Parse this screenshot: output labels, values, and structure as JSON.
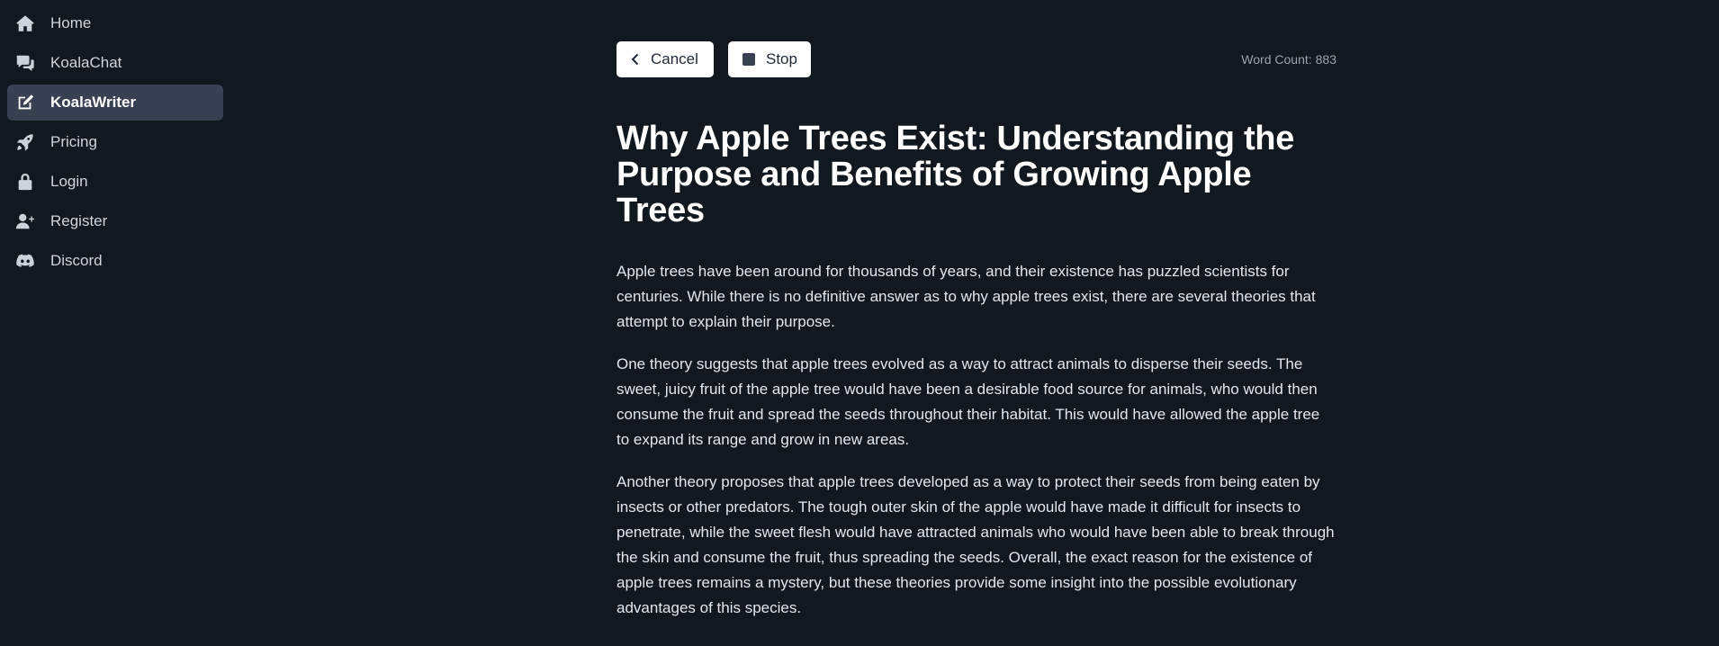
{
  "sidebar": {
    "items": [
      {
        "label": "Home",
        "icon": "home-icon",
        "active": false
      },
      {
        "label": "KoalaChat",
        "icon": "chat-icon",
        "active": false
      },
      {
        "label": "KoalaWriter",
        "icon": "edit-icon",
        "active": true
      },
      {
        "label": "Pricing",
        "icon": "rocket-icon",
        "active": false
      },
      {
        "label": "Login",
        "icon": "lock-icon",
        "active": false
      },
      {
        "label": "Register",
        "icon": "user-plus-icon",
        "active": false
      },
      {
        "label": "Discord",
        "icon": "discord-icon",
        "active": false
      }
    ]
  },
  "toolbar": {
    "cancel_label": "Cancel",
    "stop_label": "Stop",
    "word_count_label": "Word Count:",
    "word_count_value": "883"
  },
  "article": {
    "title": "Why Apple Trees Exist: Understanding the Purpose and Benefits of Growing Apple Trees",
    "paragraphs": [
      "Apple trees have been around for thousands of years, and their existence has puzzled scientists for centuries. While there is no definitive answer as to why apple trees exist, there are several theories that attempt to explain their purpose.",
      "One theory suggests that apple trees evolved as a way to attract animals to disperse their seeds. The sweet, juicy fruit of the apple tree would have been a desirable food source for animals, who would then consume the fruit and spread the seeds throughout their habitat. This would have allowed the apple tree to expand its range and grow in new areas.",
      "Another theory proposes that apple trees developed as a way to protect their seeds from being eaten by insects or other predators. The tough outer skin of the apple would have made it difficult for insects to penetrate, while the sweet flesh would have attracted animals who would have been able to break through the skin and consume the fruit, thus spreading the seeds. Overall, the exact reason for the existence of apple trees remains a mystery, but these theories provide some insight into the possible evolutionary advantages of this species."
    ]
  },
  "colors": {
    "background": "#111820",
    "active_nav": "#374151",
    "button_bg": "#ffffff"
  }
}
